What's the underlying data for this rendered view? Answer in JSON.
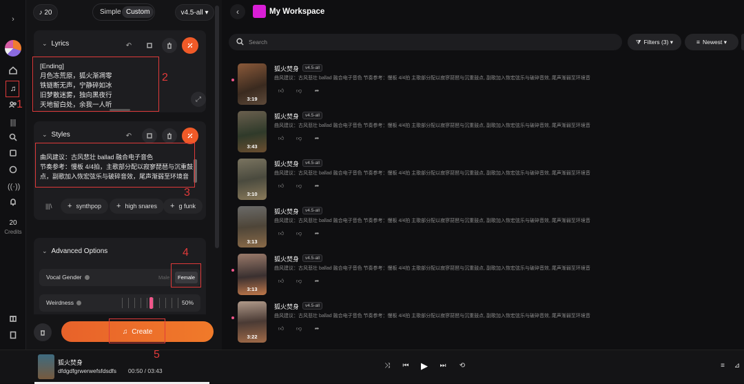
{
  "rail": {
    "credits_value": "20",
    "credits_label": "Credits"
  },
  "annotations": [
    "1",
    "2",
    "3",
    "4",
    "5"
  ],
  "panel": {
    "credits_badge": "20",
    "mode_simple": "Simple",
    "mode_custom": "Custom",
    "version": "v4.5-all",
    "lyrics": {
      "header": "Lyrics",
      "lines": [
        "[Ending]",
        "月色冻荒原，狐火渐凋零",
        "铁链断无声，宁静碎如冰",
        "旧梦散迷雾，独向黑夜行",
        "天地留白处，余我一人听"
      ]
    },
    "styles": {
      "header": "Styles",
      "lines": [
        "曲风建议：古风悲壮 ballad 融合电子音色",
        "节奏参考：慢板 4/4拍，主歌部分配以寂寥琵琶与沉重鼓",
        "点，副歌加入恢宏弦乐与破碎音效，尾声渐弱至环境音"
      ],
      "chips": [
        "synthpop",
        "high snares",
        "g funk"
      ]
    },
    "advanced": {
      "header": "Advanced Options",
      "vocal_gender_label": "Vocal Gender",
      "male": "Male",
      "female": "Female",
      "weirdness_label": "Weirdness",
      "weirdness_value": "50%"
    },
    "create_label": "Create"
  },
  "main": {
    "title": "My Workspace",
    "search_placeholder": "Search",
    "filters_label": "Filters (3)",
    "sort_label": "Newest",
    "songs": [
      {
        "title": "狐火焚身",
        "version": "v4.5-all",
        "duration": "3:19",
        "desc": "曲风建议：古风悲壮 ballad 融合电子音色 节奏参考：慢板 4/4拍 主歌部分配以寂寥琵琶与沉重鼓点, 副歌加入恢宏弦乐与破碎音效, 尾声渐弱至环境音"
      },
      {
        "title": "狐火焚身",
        "version": "v4.5-all",
        "duration": "3:43",
        "desc": "曲风建议：古风悲壮 ballad 融合电子音色 节奏参考：慢板 4/4拍 主歌部分配以寂寥琵琶与沉重鼓点, 副歌加入恢宏弦乐与破碎音效, 尾声渐弱至环境音"
      },
      {
        "title": "狐火焚身",
        "version": "v4.5-all",
        "duration": "3:10",
        "desc": "曲风建议：古风悲壮 ballad 融合电子音色 节奏参考：慢板 4/4拍 主歌部分配以寂寥琵琶与沉重鼓点, 副歌加入恢宏弦乐与破碎音效, 尾声渐弱至环境音"
      },
      {
        "title": "狐火焚身",
        "version": "v4.5-all",
        "duration": "3:13",
        "desc": "曲风建议：古风悲壮 ballad 融合电子音色 节奏参考：慢板 4/4拍 主歌部分配以寂寥琵琶与沉重鼓点, 副歌加入恢宏弦乐与破碎音效, 尾声渐弱至环境音"
      },
      {
        "title": "狐火焚身",
        "version": "v4.5-all",
        "duration": "3:13",
        "desc": "曲风建议：古风悲壮 ballad 融合电子音色 节奏参考：慢板 4/4拍 主歌部分配以寂寥琵琶与沉重鼓点, 副歌加入恢宏弦乐与破碎音效, 尾声渐弱至环境音"
      },
      {
        "title": "狐火焚身",
        "version": "v4.5-all",
        "duration": "3:22",
        "desc": "曲风建议：古风悲壮 ballad 融合电子音色 节奏参考：慢板 4/4拍 主歌部分配以寂寥琵琶与沉重鼓点, 副歌加入恢宏弦乐与破碎音效, 尾声渐弱至环境音"
      }
    ]
  },
  "player": {
    "title": "狐火焚身",
    "artist": "dfdgdfgrwerwefsfdsdfs",
    "time": "00:50 / 03:43",
    "progress": 0.22
  }
}
